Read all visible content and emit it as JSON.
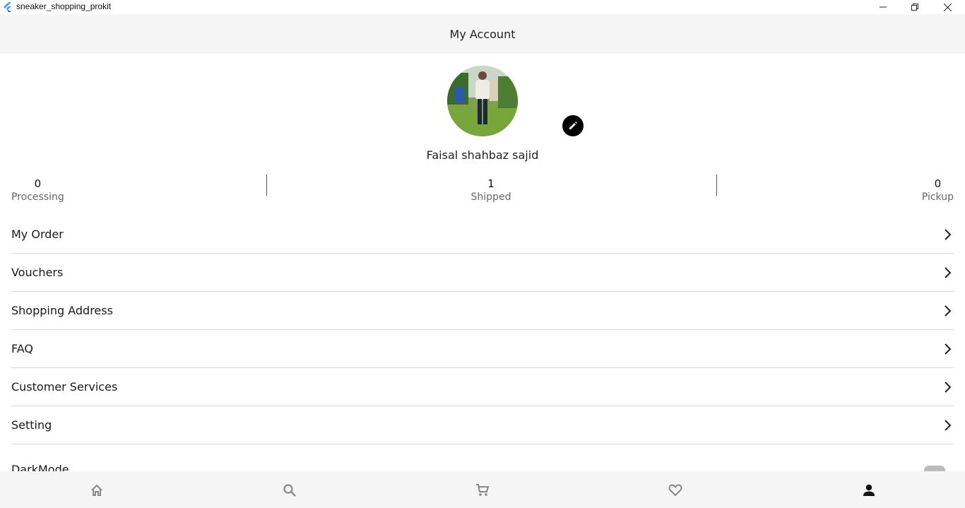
{
  "window": {
    "title": "sneaker_shopping_prokit"
  },
  "appbar": {
    "title": "My Account"
  },
  "profile": {
    "name": "Faisal shahbaz sajid"
  },
  "stats": [
    {
      "value": "0",
      "label": "Processing"
    },
    {
      "value": "1",
      "label": "Shipped"
    },
    {
      "value": "0",
      "label": "Pickup"
    }
  ],
  "menu": [
    {
      "label": "My Order"
    },
    {
      "label": "Vouchers"
    },
    {
      "label": "Shopping Address"
    },
    {
      "label": "FAQ"
    },
    {
      "label": "Customer Services"
    },
    {
      "label": "Setting"
    }
  ],
  "darkmode": {
    "label": "DarkMode",
    "enabled": false
  },
  "bottom_nav": [
    {
      "icon": "home-icon"
    },
    {
      "icon": "search-icon"
    },
    {
      "icon": "cart-icon"
    },
    {
      "icon": "heart-icon"
    },
    {
      "icon": "person-icon",
      "active": true
    }
  ],
  "colors": {
    "appbar_bg": "#f5f5f5",
    "accent": "#000000",
    "inactive_icon": "#888888"
  }
}
